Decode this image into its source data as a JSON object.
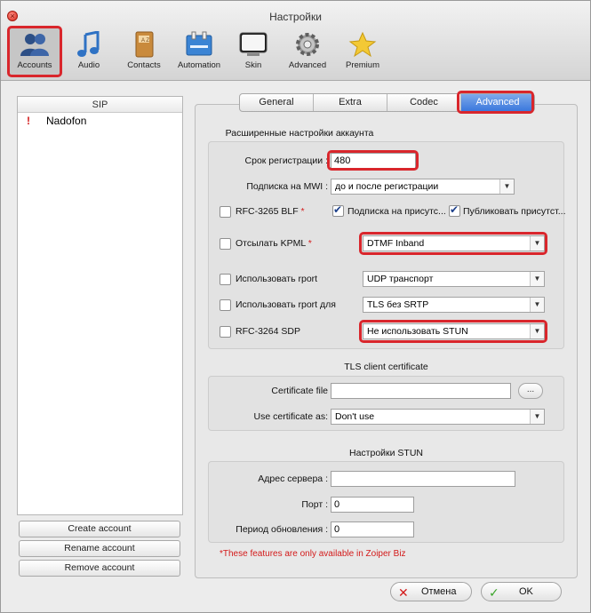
{
  "window": {
    "title": "Настройки"
  },
  "toolbar": {
    "items": [
      {
        "label": "Accounts",
        "icon": "accounts-icon"
      },
      {
        "label": "Audio",
        "icon": "audio-icon"
      },
      {
        "label": "Contacts",
        "icon": "contacts-icon"
      },
      {
        "label": "Automation",
        "icon": "automation-icon"
      },
      {
        "label": "Skin",
        "icon": "skin-icon"
      },
      {
        "label": "Advanced",
        "icon": "advanced-gear-icon"
      },
      {
        "label": "Premium",
        "icon": "premium-star-icon"
      }
    ],
    "selected": "Accounts"
  },
  "accounts_panel": {
    "header": "SIP",
    "accounts": [
      {
        "warning": "!",
        "name": "Nadofon"
      }
    ],
    "buttons": {
      "create": "Create account",
      "rename": "Rename account",
      "remove": "Remove account"
    }
  },
  "tabs": {
    "items": [
      "General",
      "Extra",
      "Codec",
      "Advanced"
    ],
    "active": "Advanced"
  },
  "advanced": {
    "section_title": "Расширенные настройки аккаунта",
    "reg_expiry": {
      "label": "Срок регистрации :",
      "value": "480"
    },
    "mwi": {
      "label": "Подписка на MWI :",
      "value": "до и после регистрации"
    },
    "blf": {
      "label": "RFC-3265 BLF",
      "star": "*",
      "checked": false,
      "presence_subscribe": {
        "label": "Подписка на присутс...",
        "checked": true
      },
      "presence_publish": {
        "label": "Публиковать присутст...",
        "checked": true
      }
    },
    "kpml": {
      "label": "Отсылать KPML",
      "star": "*",
      "checked": false,
      "value": "DTMF Inband"
    },
    "rport": {
      "label": "Использовать rport",
      "checked": false,
      "value": "UDP транспорт"
    },
    "rport_for": {
      "label": "Использовать rport для",
      "checked": false,
      "value": "TLS без SRTP"
    },
    "sdp": {
      "label": "RFC-3264 SDP",
      "checked": false,
      "value": "Не использовать STUN"
    }
  },
  "tls": {
    "section_title": "TLS client certificate",
    "cert_file": {
      "label": "Certificate file",
      "value": "",
      "browse": "..."
    },
    "use_cert": {
      "label": "Use certificate as:",
      "value": "Don't use"
    }
  },
  "stun": {
    "section_title": "Настройки STUN",
    "server": {
      "label": "Адрес сервера :",
      "value": ""
    },
    "port": {
      "label": "Порт :",
      "value": "0"
    },
    "refresh": {
      "label": "Период обновления :",
      "value": "0"
    }
  },
  "note": "*These features are only available in Zoiper Biz",
  "footer": {
    "cancel": "Отмена",
    "ok": "OK"
  },
  "colors": {
    "highlight": "#d9262c",
    "accent": "#3a78dd",
    "warning": "#d31a1a",
    "ok_check": "#3aa52a",
    "cancel_x": "#d31a1a"
  }
}
